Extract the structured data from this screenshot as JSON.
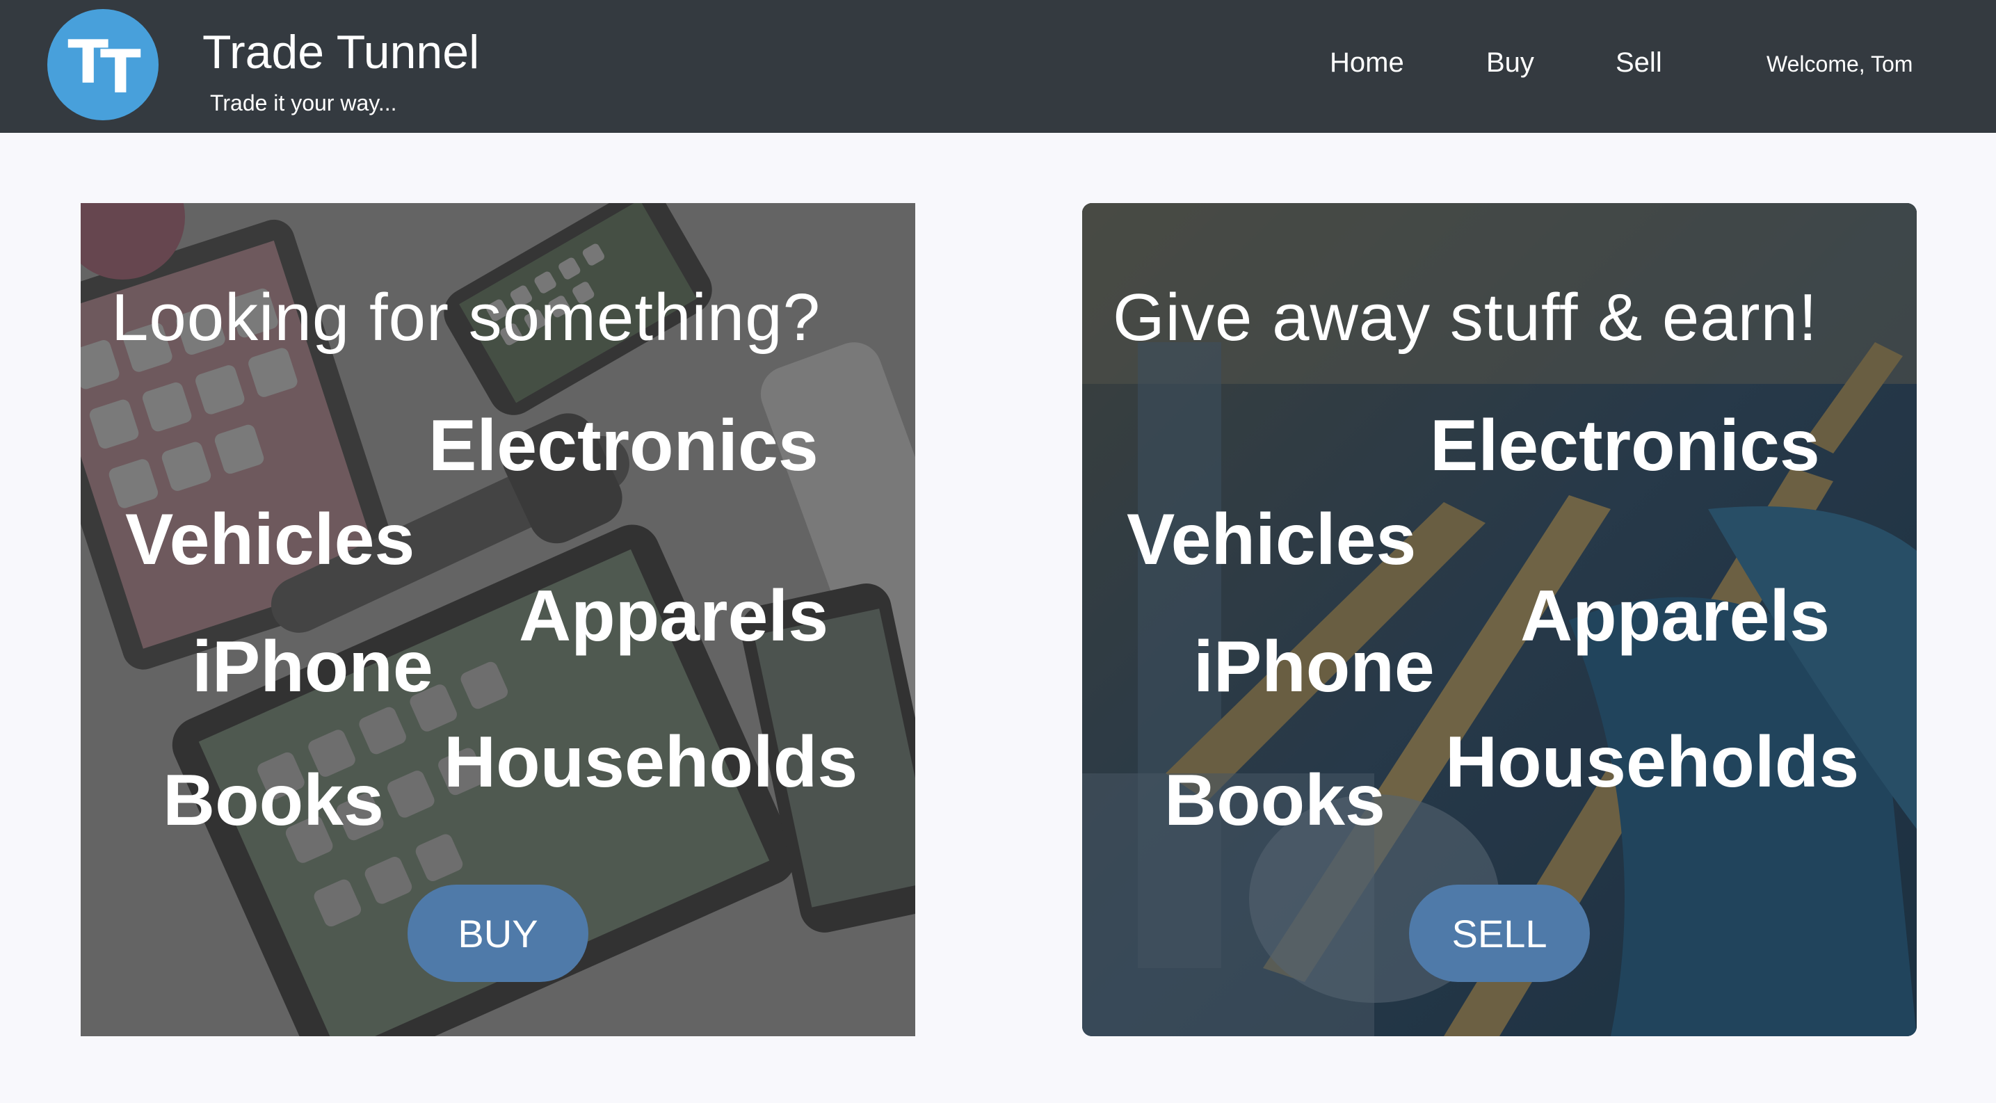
{
  "header": {
    "logo_text": "TT",
    "title": "Trade Tunnel",
    "tagline": "Trade it your way...",
    "nav": {
      "home": "Home",
      "buy": "Buy",
      "sell": "Sell"
    },
    "welcome": "Welcome, Tom"
  },
  "cards": {
    "buy": {
      "title": "Looking for something?",
      "categories": [
        "Electronics",
        "Vehicles",
        "Apparels",
        "iPhone",
        "Households",
        "Books"
      ],
      "button_label": "BUY"
    },
    "sell": {
      "title": "Give away stuff & earn!",
      "categories": [
        "Electronics",
        "Vehicles",
        "Apparels",
        "iPhone",
        "Households",
        "Books"
      ],
      "button_label": "SELL"
    }
  },
  "colors": {
    "navbar": "#343a40",
    "logo": "#48a0db",
    "button": "#4f7aa9",
    "page_bg": "#f8f8fc"
  }
}
